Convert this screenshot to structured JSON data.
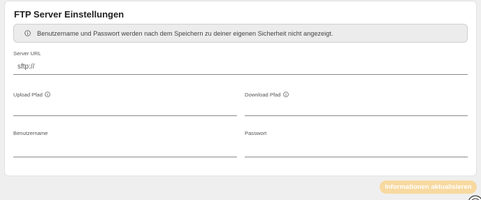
{
  "card": {
    "title": "FTP Server Einstellungen",
    "notice": {
      "icon": "info-circle-icon",
      "text": "Benutzername und Passwort werden nach dem Speichern zu deiner eigenen Sicherheit nicht angezeigt."
    }
  },
  "fields": {
    "server_url": {
      "label": "Server URL",
      "value": "sftp://"
    },
    "upload_path": {
      "label": "Upload Pfad",
      "value": "",
      "icon": "info-circle-icon"
    },
    "download_path": {
      "label": "Download Pfad",
      "value": "",
      "icon": "info-circle-icon"
    },
    "username": {
      "label": "Benutzername",
      "value": ""
    },
    "password": {
      "label": "Passwort",
      "value": ""
    }
  },
  "actions": {
    "update_label": "Informationen aktualisieren"
  },
  "colors": {
    "button_bg": "#f7d9a0",
    "background": "#efefef",
    "card_bg": "#ffffff",
    "notice_bg": "#ececec"
  }
}
